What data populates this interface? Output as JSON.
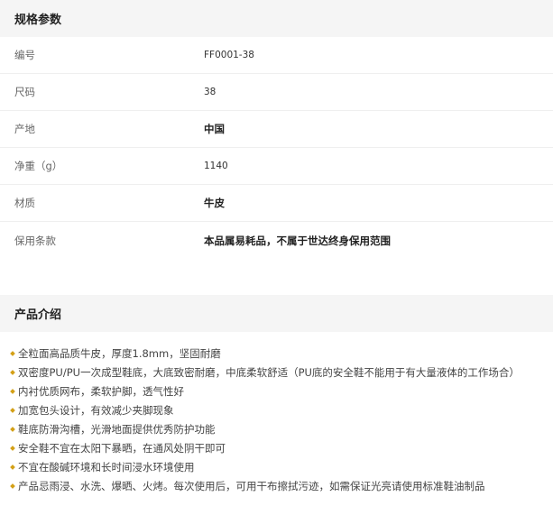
{
  "specs": {
    "title": "规格参数",
    "rows": [
      {
        "label": "编号",
        "value": "FF0001-38"
      },
      {
        "label": "尺码",
        "value": "38"
      },
      {
        "label": "产地",
        "value": "中国"
      },
      {
        "label": "净重（g）",
        "value": "1140"
      },
      {
        "label": "材质",
        "value": "牛皮"
      },
      {
        "label": "保用条款",
        "value": "本品属易耗品，不属于世达终身保用范围"
      }
    ]
  },
  "intro": {
    "title": "产品介绍",
    "items": [
      "全粒面高品质牛皮，厚度1.8mm，坚固耐磨",
      "双密度PU/PU一次成型鞋底，大底致密耐磨，中底柔软舒适（PU底的安全鞋不能用于有大量液体的工作场合）",
      "内衬优质网布，柔软护脚，透气性好",
      "加宽包头设计，有效减少夹脚现象",
      "鞋底防滑沟槽，光滑地面提供优秀防护功能",
      "安全鞋不宜在太阳下暴晒，在通风处阴干即可",
      "不宜在酸碱环境和长时间浸水环境使用",
      "产品忌雨浸、水洗、爆晒、火烤。每次使用后，可用干布擦拭污迹，如需保证光亮请使用标准鞋油制品"
    ]
  },
  "colors": {
    "header_bg": "#f5f5f5",
    "bullet": "#d4a017"
  }
}
